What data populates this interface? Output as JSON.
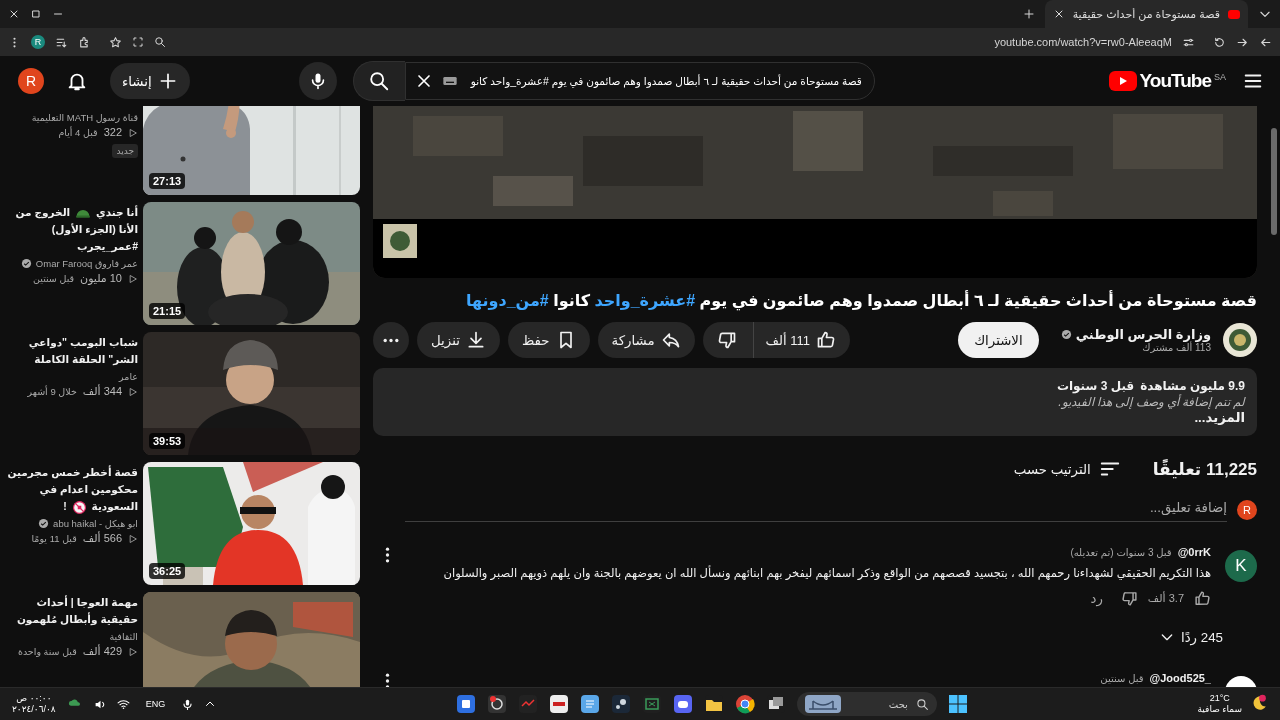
{
  "browser": {
    "tab": {
      "title": "قصة مستوحاة من أحداث حقيقية",
      "selected": true
    },
    "url": "youtube.com/watch?v=rw0-AleeaqM",
    "profile": "R"
  },
  "masthead": {
    "logo": "YouTube",
    "region": "SA",
    "search_query": "قصة مستوحاة من أحداث حقيقية لـ ٦ أبطال صمدوا وهم صائمون في يوم #عشرة_واحد كانو",
    "create": "إنشاء",
    "avatar": "R"
  },
  "video": {
    "title": [
      {
        "kind": "text",
        "text": "قصة مستوحاة من أحداث حقيقية لـ ٦ أبطال صمدوا وهم صائمون في يوم "
      },
      {
        "kind": "hashtag",
        "text": "#عشرة_واحد"
      },
      {
        "kind": "text",
        "text": " كانوا "
      },
      {
        "kind": "hashtag",
        "text": "#من_دونها"
      }
    ],
    "channel": {
      "name": "وزارة الحرس الوطني",
      "verified": true,
      "subscribers": "113 ألف مشترك",
      "subscribe": "الاشتراك"
    },
    "actions": {
      "likes": "111 ألف",
      "share": "مشاركة",
      "save": "حفظ",
      "download": "تنزيل"
    },
    "description": {
      "views": "9.9 مليون مشاهدة",
      "age": "قبل 3 سنوات",
      "text": "لم تتم إضافة أي وصف إلى هذا الفيديو.",
      "more": "المزيد..."
    }
  },
  "comments": {
    "count": "11,225 تعليقًا",
    "sort": "الترتيب حسب",
    "avatar": "R",
    "placeholder": "إضافة تعليق...",
    "items": [
      {
        "author": "@0rrK",
        "time": "قبل 3 سنوات (تم تعديله)",
        "avatar": "K",
        "color": "#1d6a4b",
        "text": "هذا التكريم الحقيقي لشهداءنا رحمهم الله ، بتجسيد قصصهم من الواقع وذكر اسمائهم ليفخر بهم ابنائهم ونسأل الله ان يعوضهم بالجنة وان يلهم ذويهم الصبر والسلوان",
        "likes": "3.7 ألف",
        "reply": "رد",
        "replies": "245 ردًا"
      },
      {
        "author": "@Jood525_",
        "time": "قبل سنتين",
        "color": "#ffffff"
      }
    ]
  },
  "related": [
    {
      "kind": "teacher",
      "channel": "قناة رسول MATH التعليمية",
      "verified": false,
      "views": "322",
      "age": "قبل 4 أيام",
      "badge": "جديد",
      "duration": "27:13"
    },
    {
      "kind": "fight",
      "title": [
        {
          "kind": "text",
          "text": "أنا جندي"
        },
        {
          "kind": "helmet"
        },
        {
          "kind": "text",
          "text": "الخروج من الأنا (الجزء الأول) #عمر_يجرب"
        }
      ],
      "channel": "عمر فاروق Omar Farooq",
      "verified": true,
      "views": "10 مليون",
      "age": "قبل سنتين",
      "duration": "21:15"
    },
    {
      "kind": "portrait",
      "title": [
        {
          "kind": "text",
          "text": "شباب البومب \"دواعي الشر\" الحلقة الكاملة"
        }
      ],
      "channel": "عامر",
      "verified": false,
      "views": "344 ألف",
      "age": "خلال 9 أشهر",
      "duration": "39:53"
    },
    {
      "kind": "flag",
      "title": [
        {
          "kind": "text",
          "text": "قصة أخطر خمس مجرمين محكومين اعدام في السعودية"
        },
        {
          "kind": "adults"
        },
        {
          "kind": "text",
          "text": "!"
        }
      ],
      "channel": "ابو هيكل - abu haikal",
      "verified": true,
      "views": "566 ألف",
      "age": "قبل 11 يومًا",
      "duration": "36:25"
    },
    {
      "kind": "desert",
      "title": [
        {
          "kind": "text",
          "text": "مهمة العوجا | أحداث حقيقية وأبطال مُلهمون"
        }
      ],
      "channel": "الثقافية",
      "verified": false,
      "views": "429 ألف",
      "age": "قبل سنة واحدة"
    }
  ],
  "taskbar": {
    "time": "٠٠:٠٠ ص",
    "date": "٢٠٢٤/٠٦/٠٨",
    "language": "ENG",
    "search": "بحث",
    "temperature": "21°C",
    "weather": "سماء صافية"
  }
}
